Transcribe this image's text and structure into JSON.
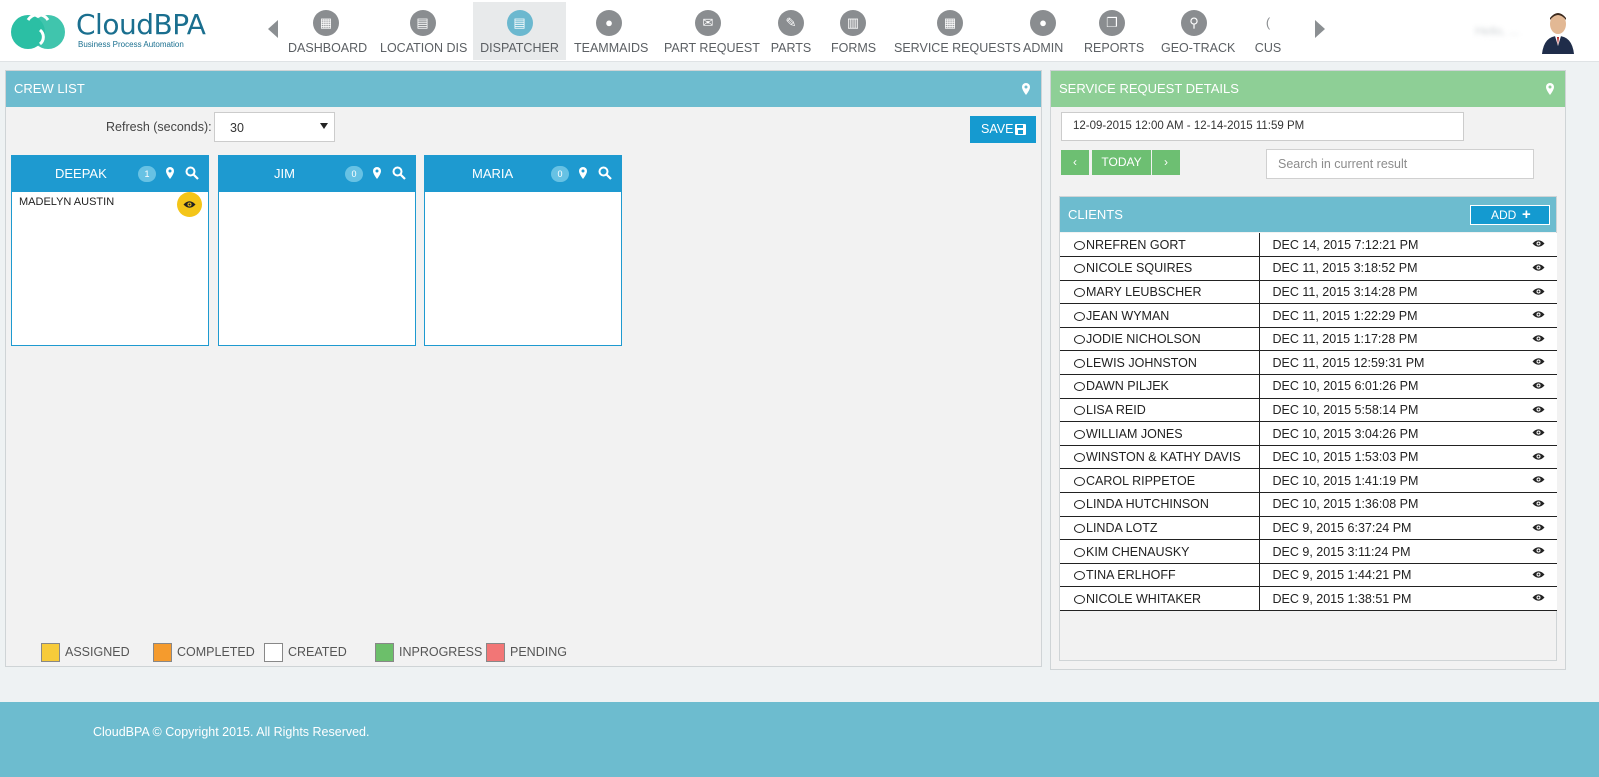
{
  "app": {
    "logo_name": "CloudBPA",
    "logo_tagline": "Business Process Automation",
    "user_name": "Hello, ..."
  },
  "nav": {
    "items": [
      {
        "label": "DASHBOARD",
        "icon": "dashboard-icon",
        "active": false
      },
      {
        "label": "LOCATION DIS",
        "icon": "location-card-icon",
        "active": false
      },
      {
        "label": "DISPATCHER",
        "icon": "dispatcher-icon",
        "active": true
      },
      {
        "label": "TEAMMAIDS",
        "icon": "team-icon",
        "active": false
      },
      {
        "label": "PART REQUEST",
        "icon": "envelope-icon",
        "active": false
      },
      {
        "label": "PARTS",
        "icon": "wrench-icon",
        "active": false
      },
      {
        "label": "FORMS",
        "icon": "forms-icon",
        "active": false
      },
      {
        "label": "SERVICE REQUESTS",
        "icon": "building-icon",
        "active": false
      },
      {
        "label": "ADMIN",
        "icon": "admin-icon",
        "active": false
      },
      {
        "label": "REPORTS",
        "icon": "reports-icon",
        "active": false
      },
      {
        "label": "GEO-TRACK",
        "icon": "map-pin-icon",
        "active": false
      },
      {
        "label": "CUS",
        "icon": "customers-icon",
        "active": false
      }
    ]
  },
  "crew_panel": {
    "title": "CREW LIST",
    "refresh_label": "Refresh (seconds):",
    "refresh_value": "30",
    "save_label": "SAVE",
    "crews": [
      {
        "name": "DEEPAK",
        "count": "1",
        "jobs": [
          {
            "client": "MADELYN AUSTIN",
            "status": "assigned",
            "status_color": "#f4c518"
          }
        ]
      },
      {
        "name": "JIM",
        "count": "0",
        "jobs": []
      },
      {
        "name": "MARIA",
        "count": "0",
        "jobs": []
      }
    ],
    "legend": [
      {
        "label": "ASSIGNED",
        "color": "#f7cb3a"
      },
      {
        "label": "COMPLETED",
        "color": "#f59b2d"
      },
      {
        "label": "CREATED",
        "color": "#ffffff"
      },
      {
        "label": "INPROGRESS",
        "color": "#6cbf6a"
      },
      {
        "label": "PENDING",
        "color": "#f27676"
      }
    ]
  },
  "service_panel": {
    "title": "SERVICE REQUEST DETAILS",
    "date_range": "12-09-2015 12:00 AM - 12-14-2015 11:59 PM",
    "today_label": "TODAY",
    "prev_label": "‹",
    "next_label": "›",
    "search_placeholder": "Search in current result",
    "clients_title": "CLIENTS",
    "add_label": "ADD",
    "clients": [
      {
        "name": "NREFREN GORT",
        "date": "DEC 14, 2015 7:12:21 PM"
      },
      {
        "name": "NICOLE SQUIRES",
        "date": "DEC 11, 2015 3:18:52 PM"
      },
      {
        "name": "MARY LEUBSCHER",
        "date": "DEC 11, 2015 3:14:28 PM"
      },
      {
        "name": "JEAN WYMAN",
        "date": "DEC 11, 2015 1:22:29 PM"
      },
      {
        "name": "JODIE NICHOLSON",
        "date": "DEC 11, 2015 1:17:28 PM"
      },
      {
        "name": "LEWIS JOHNSTON",
        "date": "DEC 11, 2015 12:59:31 PM"
      },
      {
        "name": "DAWN PILJEK",
        "date": "DEC 10, 2015 6:01:26 PM"
      },
      {
        "name": "LISA REID",
        "date": "DEC 10, 2015 5:58:14 PM"
      },
      {
        "name": "WILLIAM JONES",
        "date": "DEC 10, 2015 3:04:26 PM"
      },
      {
        "name": "WINSTON & KATHY DAVIS",
        "date": "DEC 10, 2015 1:53:03 PM"
      },
      {
        "name": "CAROL RIPPETOE",
        "date": "DEC 10, 2015 1:41:19 PM"
      },
      {
        "name": "LINDA HUTCHINSON",
        "date": "DEC 10, 2015 1:36:08 PM"
      },
      {
        "name": "LINDA LOTZ",
        "date": "DEC 9, 2015 6:37:24 PM"
      },
      {
        "name": "KIM CHENAUSKY",
        "date": "DEC 9, 2015 3:11:24 PM"
      },
      {
        "name": "TINA ERLHOFF",
        "date": "DEC 9, 2015 1:44:21 PM"
      },
      {
        "name": "NICOLE WHITAKER",
        "date": "DEC 9, 2015 1:38:51 PM"
      }
    ]
  },
  "footer": {
    "copyright": "CloudBPA © Copyright 2015. All Rights Reserved."
  },
  "colors": {
    "header_blue": "#6dbccf",
    "header_green": "#8ecf96",
    "crew_blue": "#1e9ad0",
    "button_green": "#6dbf72"
  }
}
